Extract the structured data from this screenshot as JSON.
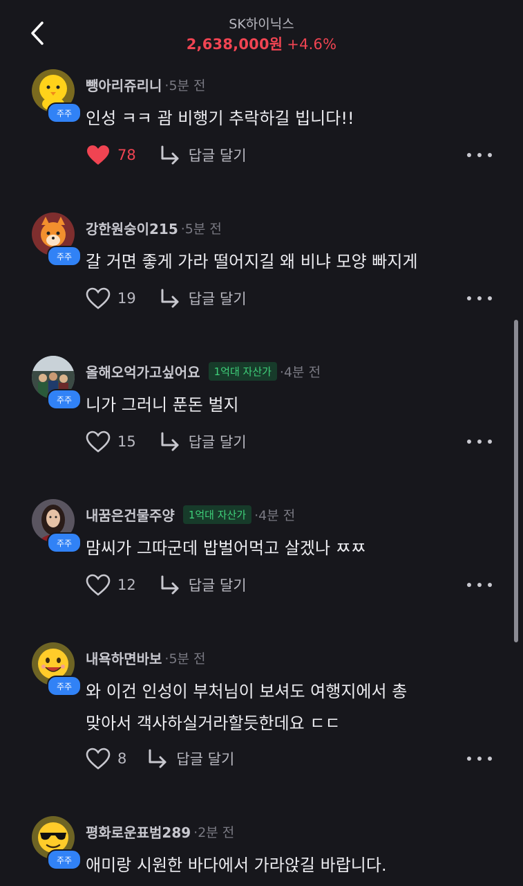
{
  "header": {
    "stock_name": "SK하이닉스",
    "price": "2,638,000원",
    "change": "+4.6%"
  },
  "badge_label": "주주",
  "reply_label": "답글 달기",
  "comments": [
    {
      "author": "뺑아리쥬리니",
      "time": "·5분 전",
      "lines": [
        "인성 ㅋㅋ 괌 비행기 추락하길 빕니다!!"
      ],
      "likes": "78",
      "liked": true,
      "avatar_icon": "chick-avatar-icon"
    },
    {
      "author": "강한원숭이215",
      "time": "·5분 전",
      "lines": [
        "갈 거면 좋게 가라 떨어지길 왜 비냐 모양 빠지게"
      ],
      "likes": "19",
      "liked": false,
      "avatar_icon": "fox-avatar-icon"
    },
    {
      "author": "올해오억가고싶어요",
      "asset_tag": "1억대 자산가",
      "time": "·4분 전",
      "lines": [
        "니가 그러니 푼돈 벌지"
      ],
      "likes": "15",
      "liked": false,
      "avatar_icon": "photo-avatar-icon"
    },
    {
      "author": "내꿈은건물주양",
      "asset_tag": "1억대 자산가",
      "time": "·4분 전",
      "lines": [
        "맘씨가 그따군데 밥벌어먹고 살겠나 ㅉㅉ"
      ],
      "likes": "12",
      "liked": false,
      "avatar_icon": "portrait-avatar-icon"
    },
    {
      "author": "내욕하면바보",
      "time": "·5분 전",
      "lines": [
        "와 이건 인성이 부처님이 보셔도 여행지에서 총",
        "맞아서 객사하실거라할듯한데요 ㄷㄷ"
      ],
      "likes": "8",
      "liked": false,
      "avatar_icon": "smiley-avatar-icon"
    },
    {
      "author": "평화로운표범289",
      "time": "·2분 전",
      "lines": [
        "애미랑 시원한 바다에서 가라앉길 바랍니다."
      ],
      "avatar_icon": "sunglasses-avatar-icon"
    }
  ],
  "colors": {
    "background": "#17171c",
    "price_red": "#f04452",
    "badge_blue": "#3182f6",
    "asset_green": "#3fd07a"
  }
}
